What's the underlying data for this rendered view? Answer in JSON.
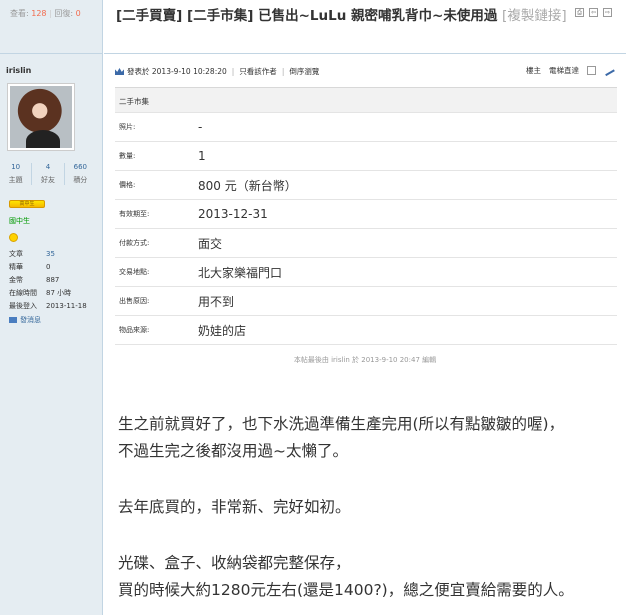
{
  "thread": {
    "views_label": "查看:",
    "views": "128",
    "sep": "|",
    "replies_label": "回復:",
    "replies": "0",
    "title": "[二手買賣] [二手市集] 已售出~LuLu 親密哺乳背巾~未使用過",
    "copy_link": "[複製鏈接]",
    "tools": [
      "⎙",
      "⇦",
      "⇨"
    ]
  },
  "author": {
    "name": "irislin",
    "stats": [
      {
        "value": "10",
        "label": "主題"
      },
      {
        "value": "4",
        "label": "好友"
      },
      {
        "value": "660",
        "label": "積分"
      }
    ],
    "badge": "高中生",
    "group": "國中生",
    "info": [
      {
        "key": "文章",
        "value": "35",
        "link": true
      },
      {
        "key": "精華",
        "value": "0",
        "link": false
      },
      {
        "key": "金幣",
        "value": "887",
        "link": false
      },
      {
        "key": "在線時間",
        "value": "87 小時",
        "link": false
      },
      {
        "key": "最後登入",
        "value": "2013-11-18",
        "link": false
      }
    ],
    "send_pm": "發消息"
  },
  "post": {
    "posted": "發表於 2013-9-10 10:28:20",
    "only_author": "只看該作者",
    "reverse": "倒序瀏覽",
    "floor": "樓主",
    "elevator": "電梯直達",
    "market": "二手市集",
    "fields": [
      {
        "key": "照片:",
        "value": "-"
      },
      {
        "key": "數量:",
        "value": "1"
      },
      {
        "key": "價格:",
        "value": "800 元（新台幣）"
      },
      {
        "key": "有效期至:",
        "value": "2013-12-31"
      },
      {
        "key": "付款方式:",
        "value": "面交"
      },
      {
        "key": "交易地點:",
        "value": "北大家樂福門口"
      },
      {
        "key": "出售原因:",
        "value": "用不到"
      },
      {
        "key": "物品來源:",
        "value": "奶娃的店"
      }
    ],
    "edited": "本帖最後由 irislin 於 2013-9-10 20:47 編輯",
    "body": [
      "生之前就買好了，也下水洗過準備生產完用(所以有點皺皺的喔)，",
      "不過生完之後都沒用過~太懶了。",
      "去年底買的，非常新、完好如初。",
      "光碟、盒子、收納袋都完整保存，",
      "買的時候大約1280元左右(還是1400?)，總之便宜賣給需要的人。"
    ]
  }
}
